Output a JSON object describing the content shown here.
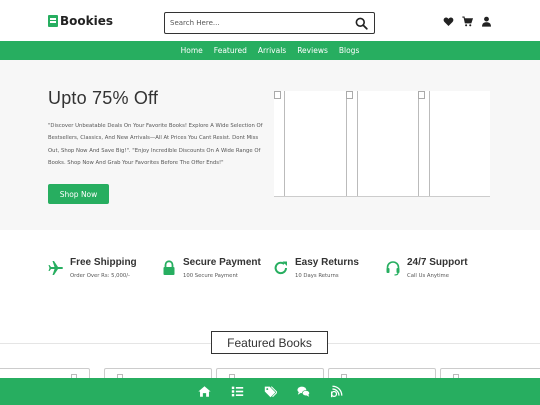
{
  "brand": {
    "name": "Bookies",
    "accent": "#27ae60"
  },
  "search": {
    "placeholder": "Search Here..."
  },
  "header_icons": [
    "heart-icon",
    "cart-icon",
    "user-icon"
  ],
  "nav": {
    "items": [
      "Home",
      "Featured",
      "Arrivals",
      "Reviews",
      "Blogs"
    ]
  },
  "hero": {
    "title": "Upto 75% Off",
    "description": "\"Discover Unbeatable Deals On Your Favorite Books! Explore A Wide Selection Of Bestsellers, Classics, And New Arrivals—All At Prices You Cant Resist. Dont Miss Out, Shop Now And Save Big!\". \"Enjoy Incredible Discounts On A Wide Range Of Books. Shop Now And Grab Your Favorites Before The Offer Ends!\"",
    "button": "Shop Now"
  },
  "features": [
    {
      "icon": "plane-icon",
      "title": "Free Shipping",
      "subtitle": "Order Over Rs: 5,000/-"
    },
    {
      "icon": "lock-icon",
      "title": "Secure Payment",
      "subtitle": "100 Secure Payment"
    },
    {
      "icon": "redo-icon",
      "title": "Easy Returns",
      "subtitle": "10 Days Returns"
    },
    {
      "icon": "headset-icon",
      "title": "24/7 Support",
      "subtitle": "Call Us Anytime"
    }
  ],
  "featured_section": {
    "title": "Featured Books"
  },
  "bottom_nav": [
    "home-icon",
    "list-icon",
    "tags-icon",
    "comments-icon",
    "blog-icon"
  ]
}
